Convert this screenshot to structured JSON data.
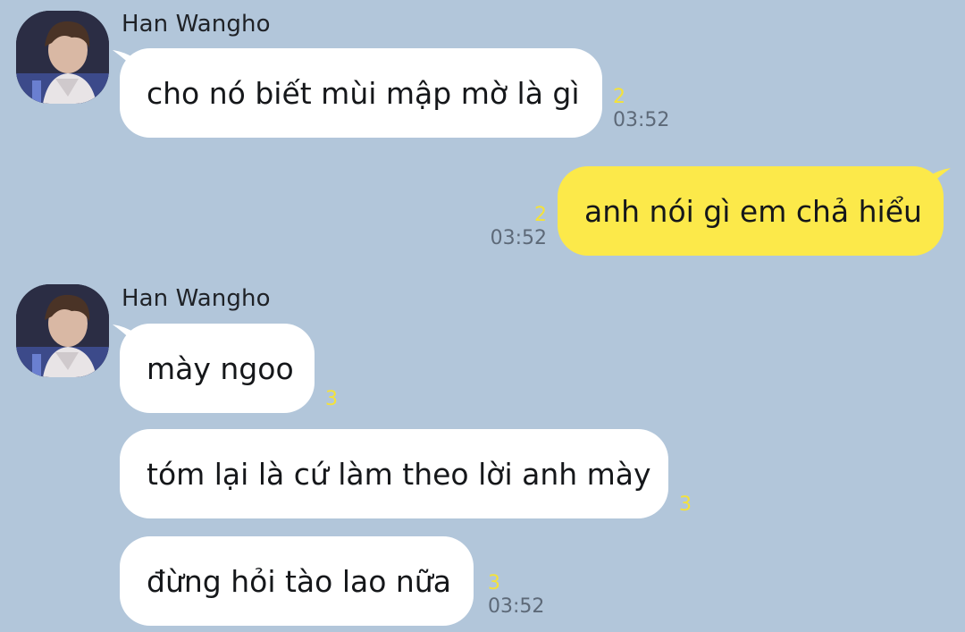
{
  "colors": {
    "background": "#b2c6da",
    "incoming_bubble": "#ffffff",
    "outgoing_bubble": "#fce94a",
    "unread_count": "#f4e23a",
    "timestamp": "#5d6978"
  },
  "groups": [
    {
      "sender": "Han Wangho",
      "avatar": "profile-photo-icon",
      "messages": [
        {
          "text": "cho nó biết mùi mập mờ là gì",
          "unread": "2",
          "time": "03:52"
        }
      ]
    },
    {
      "outgoing": true,
      "messages": [
        {
          "text": "anh nói gì em chả hiểu",
          "unread": "2",
          "time": "03:52"
        }
      ]
    },
    {
      "sender": "Han Wangho",
      "avatar": "profile-photo-icon",
      "messages": [
        {
          "text": "mày ngoo",
          "unread": "3"
        },
        {
          "text": "tóm lại là cứ làm theo lời anh mày",
          "unread": "3"
        },
        {
          "text": "đừng hỏi tào lao nữa",
          "unread": "3",
          "time": "03:52"
        }
      ]
    }
  ]
}
